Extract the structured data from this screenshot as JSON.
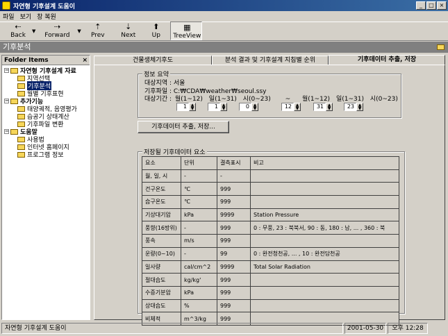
{
  "window": {
    "title": "자연형 기후설계 도움이",
    "controls": [
      "_",
      "□",
      "×"
    ]
  },
  "menu": [
    "파일",
    "보기",
    "창 복원"
  ],
  "toolbar": {
    "back": "Back",
    "forward": "Forward",
    "prev": "Prev",
    "next": "Next",
    "up": "Up",
    "treeview": "TreeView",
    "back_icon": "⇠",
    "forward_icon": "⇢",
    "prev_icon": "⇡",
    "next_icon": "⇣",
    "up_icon": "⬆",
    "tree_icon": "▦"
  },
  "band": {
    "title": "기후분석"
  },
  "folder_pane": {
    "header": "Folder Items",
    "close": "×",
    "tree": [
      {
        "label": "자연형 기후설계 자료",
        "level": 1,
        "expanded": true
      },
      {
        "label": "지역선택",
        "level": 2
      },
      {
        "label": "기후분석",
        "level": 2,
        "selected": true
      },
      {
        "label": "월별 기후표현",
        "level": 2
      },
      {
        "label": "추가기능",
        "level": 1,
        "expanded": true
      },
      {
        "label": "태양궤적, 음영평가",
        "level": 2
      },
      {
        "label": "습공기 상태계산",
        "level": 2
      },
      {
        "label": "기후파일 변환",
        "level": 2
      },
      {
        "label": "도움말",
        "level": 1,
        "expanded": true
      },
      {
        "label": "사용법",
        "level": 2
      },
      {
        "label": "인터넷 홈페이지",
        "level": 2
      },
      {
        "label": "프로그램 정보",
        "level": 2
      }
    ]
  },
  "tabs": [
    "건물생체기후도",
    "분석 결과 및 기후설계 지침별 순위",
    "기후데이터 추출, 저장"
  ],
  "info": {
    "legend": "정보 요약",
    "region_label": "대상지역 :",
    "region": "서울",
    "file_label": "기후파일 :",
    "file": "C:₩CDA₩weather₩seoul.ssy",
    "period_label": "대상기간 :",
    "month_label": "월(1~12)",
    "day_label": "일(1~31)",
    "hour_label": "시(0~23)",
    "dash": "~",
    "start": {
      "month": "1",
      "day": "1",
      "hour": "0"
    },
    "end": {
      "month": "12",
      "day": "31",
      "hour": "23"
    }
  },
  "extract_button": "기후데이터 추출, 저장...",
  "table": {
    "legend": "저장될 기후데이터 요소",
    "headers": [
      "요소",
      "단위",
      "결측표시",
      "비고"
    ],
    "rows": [
      [
        "월, 일, 시",
        "-",
        "-",
        ""
      ],
      [
        "건구온도",
        "℃",
        "999",
        ""
      ],
      [
        "습구온도",
        "℃",
        "999",
        ""
      ],
      [
        "기상대기압",
        "kPa",
        "9999",
        "Station Pressure"
      ],
      [
        "풍향(16방위)",
        "-",
        "999",
        "0 : 무풍, 23 : 북북서, 90 : 동, 180 : 남, ... , 360 : 북"
      ],
      [
        "풍속",
        "m/s",
        "999",
        ""
      ],
      [
        "운량(0~10)",
        "-",
        "99",
        "0 : 완전청천공, ... , 10 : 완전담천공"
      ],
      [
        "일사량",
        "cal/cm^2",
        "9999",
        "Total Solar Radiation"
      ],
      [
        "절대습도",
        "kg/kg'",
        "999",
        ""
      ],
      [
        "수증기분압",
        "kPa",
        "999",
        ""
      ],
      [
        "상대습도",
        "%",
        "999",
        ""
      ],
      [
        "비체적",
        "m^3/kg",
        "999",
        ""
      ]
    ]
  },
  "status": {
    "app": "자연형 기후설계 도움이",
    "date": "2001-05-30",
    "time": "오후 12:28"
  }
}
